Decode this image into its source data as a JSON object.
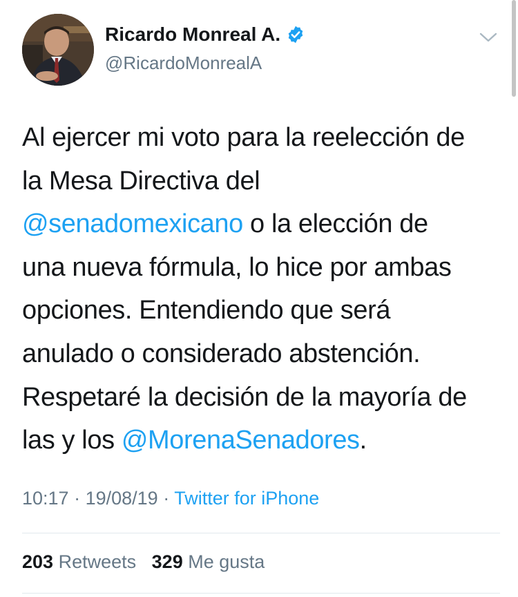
{
  "tweet": {
    "author": {
      "name": "Ricardo Monreal A.",
      "handle": "@RicardoMonrealA",
      "verified": true
    },
    "lines": [
      [
        {
          "text": "Al ejercer mi voto para la reelección de",
          "mention": false
        }
      ],
      [
        {
          "text": "la Mesa Directiva del",
          "mention": false
        }
      ],
      [
        {
          "text": "@senadomexicano",
          "mention": true
        },
        {
          "text": " o la elección de",
          "mention": false
        }
      ],
      [
        {
          "text": "una nueva fórmula, lo hice por ambas",
          "mention": false
        }
      ],
      [
        {
          "text": "opciones. Entendiendo que será",
          "mention": false
        }
      ],
      [
        {
          "text": "anulado o considerado abstención.",
          "mention": false
        }
      ],
      [
        {
          "text": "Respetaré la decisión de la mayoría de",
          "mention": false
        }
      ],
      [
        {
          "text": "las y los ",
          "mention": false
        },
        {
          "text": "@MorenaSenadores",
          "mention": true
        },
        {
          "text": ".",
          "mention": false
        }
      ]
    ],
    "meta": {
      "time": "10:17",
      "date": "19/08/19",
      "separator": " · ",
      "source": "Twitter for iPhone"
    },
    "stats": {
      "retweets_count": "203",
      "retweets_label": "Retweets",
      "likes_count": "329",
      "likes_label": "Me gusta"
    }
  },
  "colors": {
    "link": "#1da1f2",
    "text": "#14171a",
    "secondary": "#657786",
    "divider": "#e1e8ed"
  },
  "icons": {
    "verified": "verified-badge-icon",
    "menu": "chevron-down-icon"
  }
}
